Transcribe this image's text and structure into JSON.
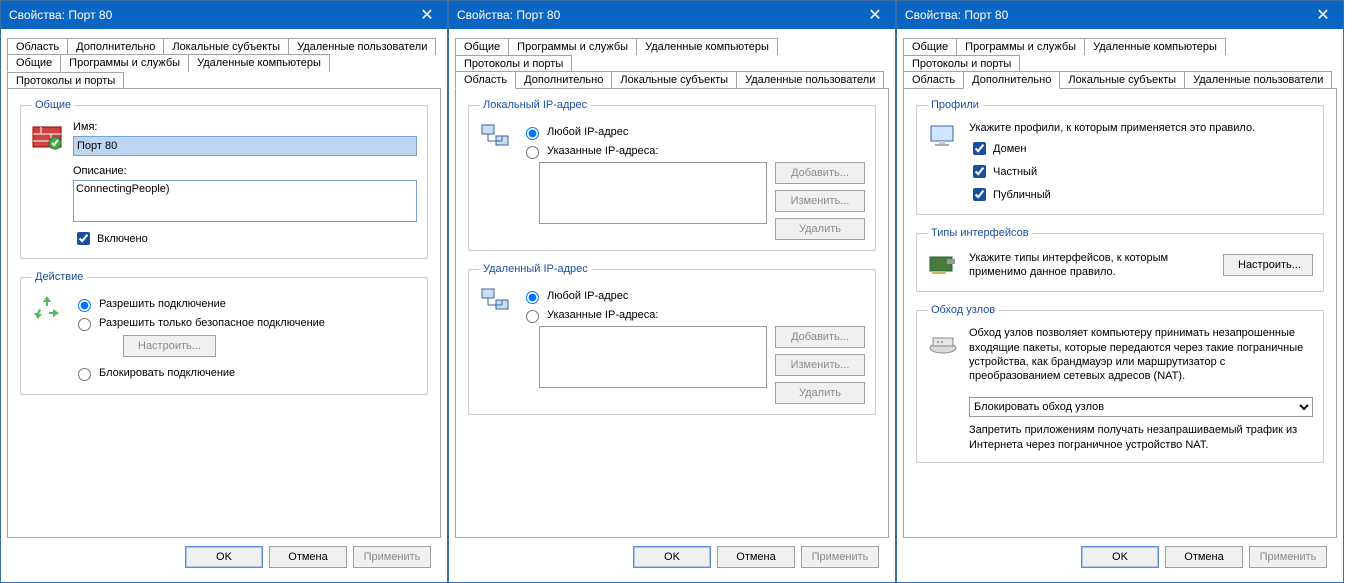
{
  "title": "Свойства: Порт 80",
  "close": "✕",
  "tabs": {
    "row1": [
      "Область",
      "Дополнительно",
      "Локальные субъекты",
      "Удаленные пользователи"
    ],
    "row2": [
      "Общие",
      "Программы и службы",
      "Удаленные компьютеры",
      "Протоколы и порты"
    ],
    "row2b": [
      "Общие",
      "Программы и службы",
      "Удаленные компьютеры",
      "Протоколы и порты"
    ],
    "row2c": [
      "Область",
      "Дополнительно",
      "Локальные субъекты",
      "Удаленные пользователи"
    ]
  },
  "general": {
    "legend": "Общие",
    "name_label": "Имя:",
    "name_value": "Порт 80",
    "desc_label": "Описание:",
    "desc_value": "ConnectingPeople)",
    "enabled": "Включено"
  },
  "action": {
    "legend": "Действие",
    "allow": "Разрешить подключение",
    "secure": "Разрешить только безопасное подключение",
    "configure": "Настроить...",
    "block": "Блокировать подключение"
  },
  "scope": {
    "local_legend": "Локальный IP-адрес",
    "remote_legend": "Удаленный IP-адрес",
    "any": "Любой IP-адрес",
    "specific": "Указанные IP-адреса:",
    "add": "Добавить...",
    "edit": "Изменить...",
    "del": "Удалить"
  },
  "adv": {
    "profiles_legend": "Профили",
    "profiles_desc": "Укажите профили, к которым применяется это правило.",
    "domain": "Домен",
    "private": "Частный",
    "public": "Публичный",
    "iface_legend": "Типы интерфейсов",
    "iface_desc": "Укажите типы интерфейсов, к которым применимо данное правило.",
    "iface_btn": "Настроить...",
    "traversal_legend": "Обход узлов",
    "traversal_desc": "Обход узлов позволяет компьютеру принимать незапрошенные входящие пакеты, которые передаются через такие пограничные устройства, как брандмауэр или маршрутизатор с преобразованием сетевых адресов (NAT).",
    "traversal_sel": "Блокировать обход узлов",
    "traversal_hint": "Запретить приложениям получать незапрашиваемый трафик из Интернета через пограничное устройство NAT."
  },
  "footer": {
    "ok": "OK",
    "cancel": "Отмена",
    "apply": "Применить"
  }
}
